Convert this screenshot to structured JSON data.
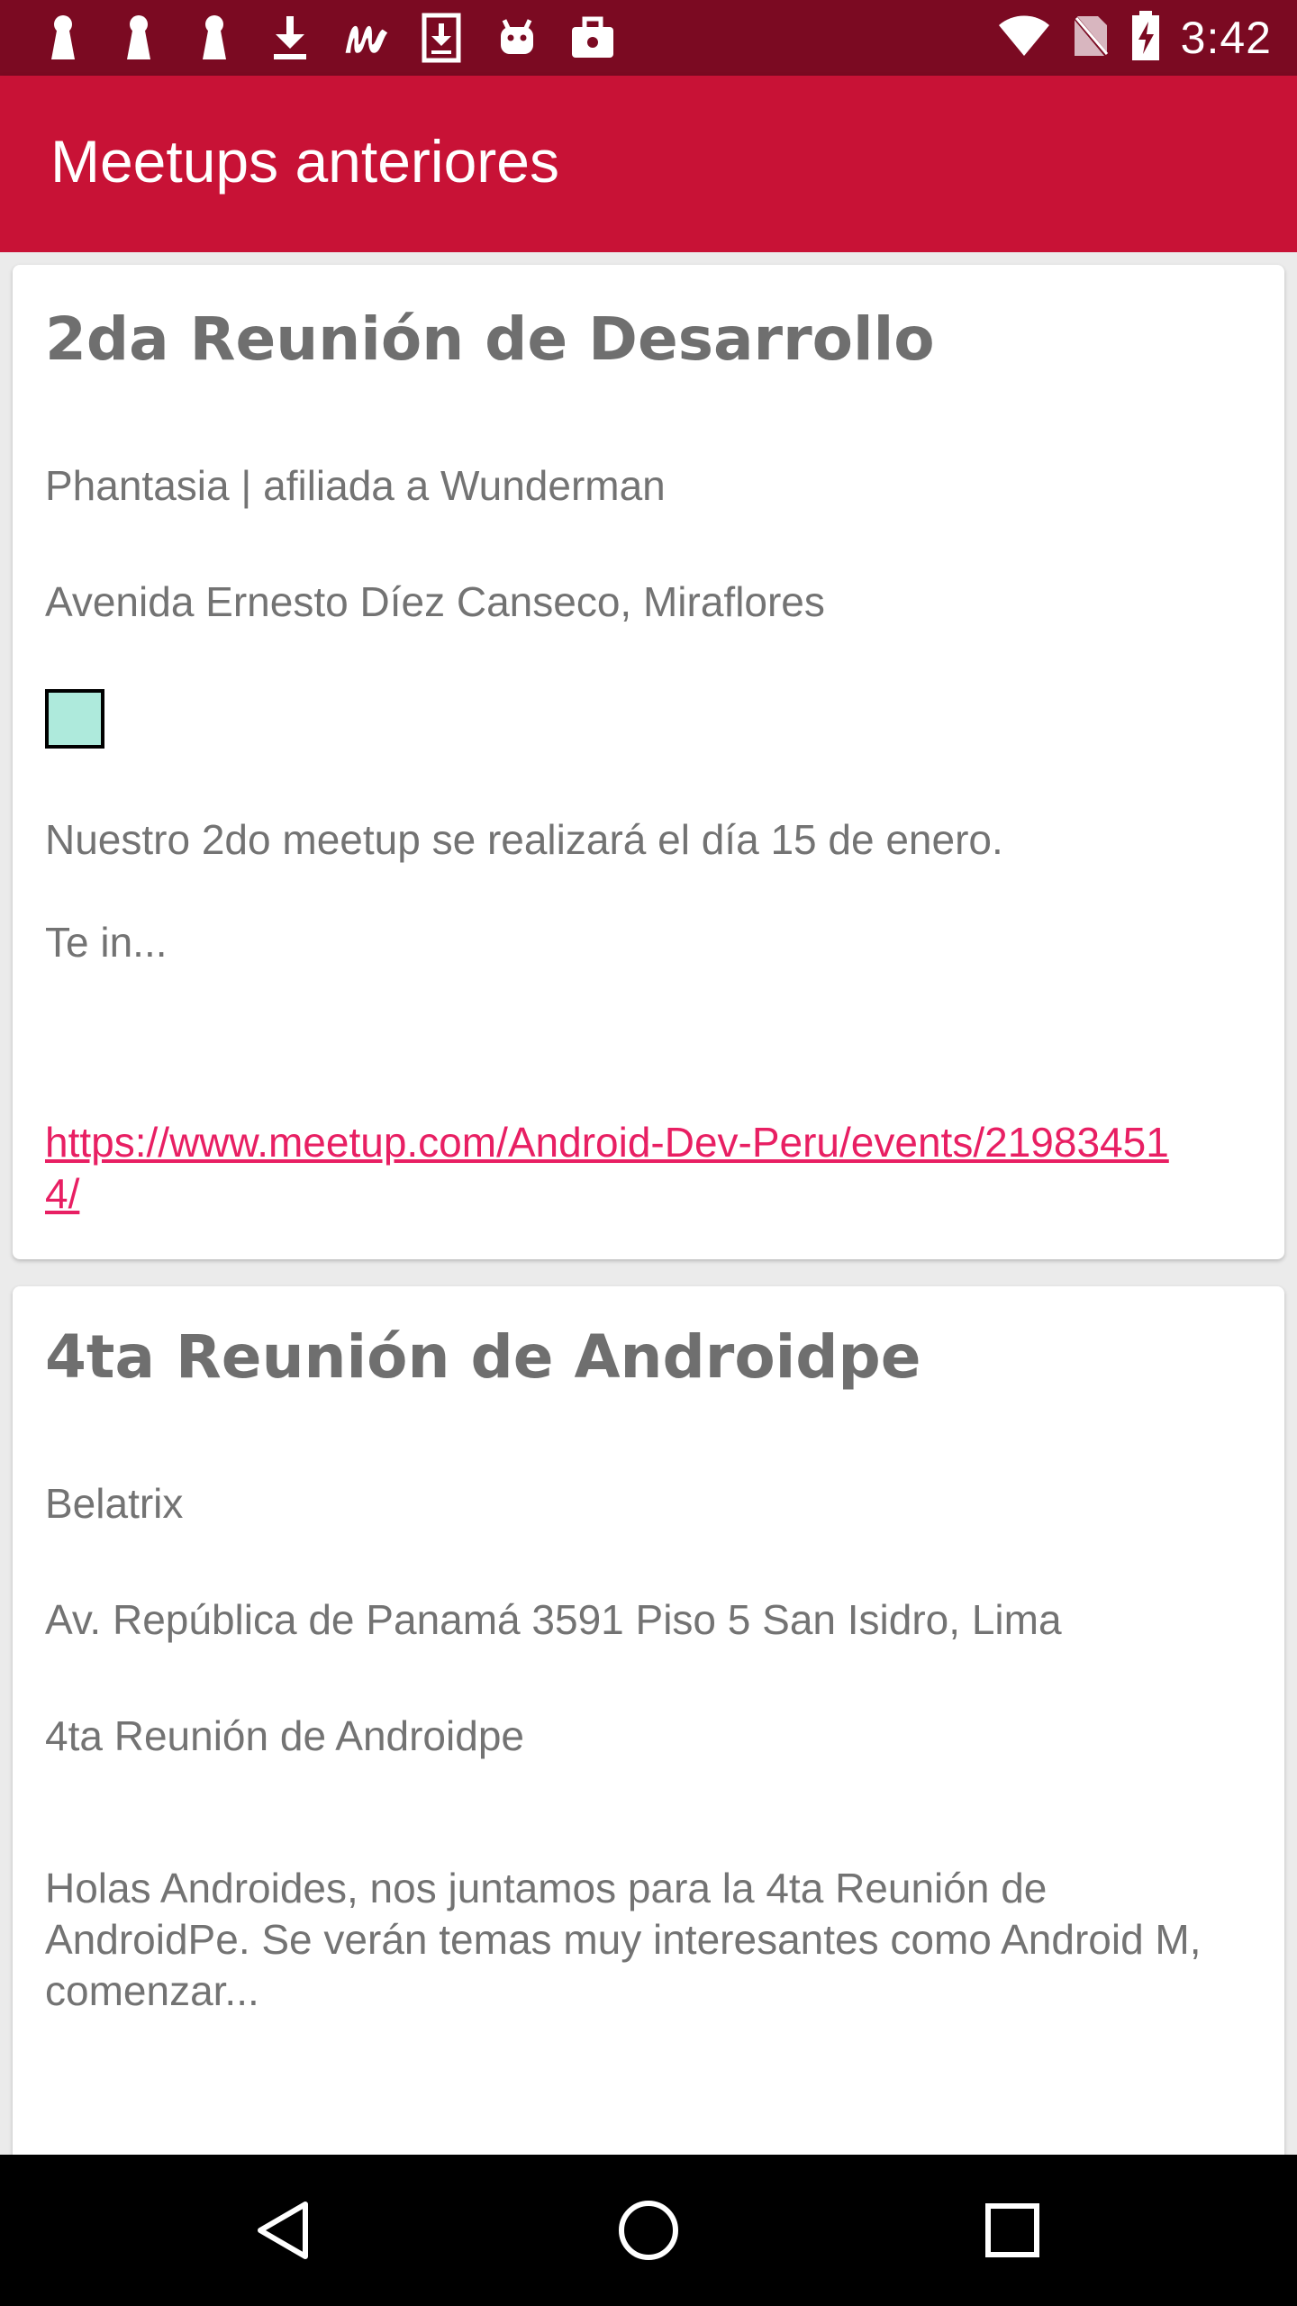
{
  "status_bar": {
    "time": "3:42",
    "left_icons": [
      "keyhole-icon",
      "keyhole-icon",
      "keyhole-icon",
      "download-icon",
      "meetup-icon",
      "download-box-icon",
      "android-icon",
      "briefcase-icon"
    ],
    "right_icons": [
      "wifi-icon",
      "no-sim-icon",
      "battery-charging-icon"
    ]
  },
  "app_bar": {
    "title": "Meetups anteriores"
  },
  "meetups": [
    {
      "title": "2da Reunión de Desarrollo",
      "venue": "Phantasia | afiliada a Wunderman",
      "address": "Avenida Ernesto Díez Canseco, Miraflores",
      "description_line1": "Nuestro 2do meetup se realizará el día 15 de enero.",
      "description_line2": "Te in...",
      "link": "https://www.meetup.com/Android-Dev-Peru/events/219834514/"
    },
    {
      "title": "4ta Reunión de Androidpe",
      "venue": "Belatrix",
      "address": "Av. República de Panamá 3591 Piso 5 San Isidro, Lima",
      "subtitle": "4ta Reunión de Androidpe",
      "description": "Holas Androides, nos juntamos para la 4ta Reunión de AndroidPe. Se verán temas muy interesantes como Android M, comenzar..."
    }
  ],
  "colors": {
    "status_bar": "#7b0a22",
    "app_bar": "#c81236",
    "link": "#e81f63",
    "thumbnail": "#aeeadc"
  },
  "nav_bar": {
    "icons": [
      "back-icon",
      "home-icon",
      "recents-icon"
    ]
  }
}
